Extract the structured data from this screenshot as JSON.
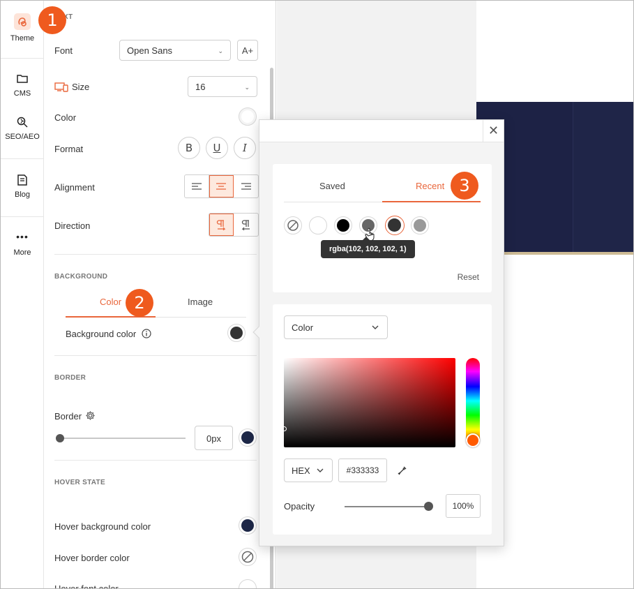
{
  "rail": {
    "items": [
      {
        "label": "Theme",
        "icon": "theme-icon"
      },
      {
        "label": "CMS",
        "icon": "folder-icon"
      },
      {
        "label": "SEO/AEO",
        "icon": "seo-search-icon"
      },
      {
        "label": "Blog",
        "icon": "blog-icon"
      },
      {
        "label": "More",
        "icon": "more-dots-icon"
      }
    ]
  },
  "callouts": {
    "one": "1",
    "two": "2",
    "three": "3"
  },
  "text_section": {
    "title_partial": "XT",
    "font_label": "Font",
    "font_value": "Open Sans",
    "font_add_glyph": "A+",
    "size_label": "Size",
    "size_value": "16",
    "color_label": "Color",
    "format_label": "Format",
    "bold": "B",
    "underline": "U",
    "italic": "I",
    "alignment_label": "Alignment",
    "direction_label": "Direction"
  },
  "background_section": {
    "title": "BACKGROUND",
    "tab_color": "Color",
    "tab_image": "Image",
    "bg_color_label": "Background color",
    "bg_color_value": "#333333"
  },
  "border_section": {
    "title": "BORDER",
    "border_label": "Border",
    "border_width": "0px",
    "border_color": "#1d2747"
  },
  "hover_section": {
    "title": "HOVER STATE",
    "hover_bg_label": "Hover background color",
    "hover_bg_color": "#1d2747",
    "hover_border_label": "Hover border color",
    "hover_font_label": "Hover font color"
  },
  "color_popup": {
    "tab_saved": "Saved",
    "tab_recent": "Recent",
    "recent_swatches": [
      "none",
      "#ffffff",
      "#000000",
      "#666666",
      "#333333",
      "#999999"
    ],
    "selected_swatch": "#333333",
    "tooltip": "rgba(102, 102, 102, 1)",
    "reset": "Reset",
    "mode_select": "Color",
    "format_select": "HEX",
    "hex_value": "#333333",
    "opacity_label": "Opacity",
    "opacity_value": "100%"
  },
  "colors": {
    "accent": "#e9663b",
    "callout": "#ef5a1e",
    "navy": "#1d2245"
  }
}
